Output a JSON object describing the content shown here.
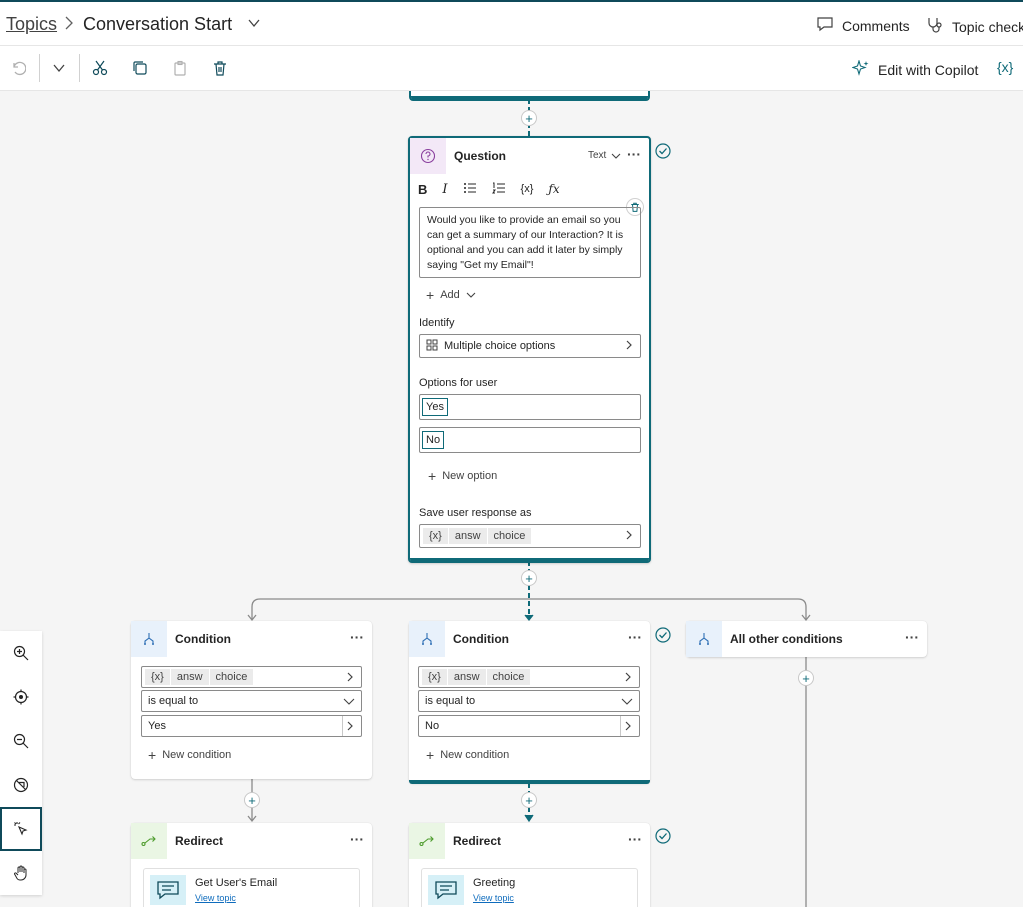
{
  "header": {
    "breadcrumb_root": "Topics",
    "title": "Conversation Start",
    "comments_label": "Comments",
    "topic_checker_label": "Topic check"
  },
  "toolbar": {
    "edit_copilot_label": "Edit with Copilot",
    "variables_label": "{x}"
  },
  "question_node": {
    "title": "Question",
    "type_label": "Text",
    "message": "Would you like to provide an email so you can get a summary of our Interaction? It is optional and you can add it later by simply saying \"Get my Email\"!",
    "add_label": "Add",
    "identify_label": "Identify",
    "identify_value": "Multiple choice options",
    "options_label": "Options for user",
    "options": [
      "Yes",
      "No"
    ],
    "new_option_label": "New option",
    "save_label": "Save user response as",
    "save_chips": [
      "answ",
      "choice"
    ],
    "var_glyph": "{x}"
  },
  "conditions": [
    {
      "title": "Condition",
      "chips": [
        "answ",
        "choice"
      ],
      "operator": "is equal to",
      "value": "Yes",
      "new_condition_label": "New condition"
    },
    {
      "title": "Condition",
      "chips": [
        "answ",
        "choice"
      ],
      "operator": "is equal to",
      "value": "No",
      "new_condition_label": "New condition"
    },
    {
      "title": "All other conditions"
    }
  ],
  "redirects": [
    {
      "title": "Redirect",
      "topic": "Get User's Email",
      "link": "View topic"
    },
    {
      "title": "Redirect",
      "topic": "Greeting",
      "link": "View topic"
    }
  ],
  "colors": {
    "accent": "#0f6a78",
    "header_border": "#0f4a5a"
  }
}
